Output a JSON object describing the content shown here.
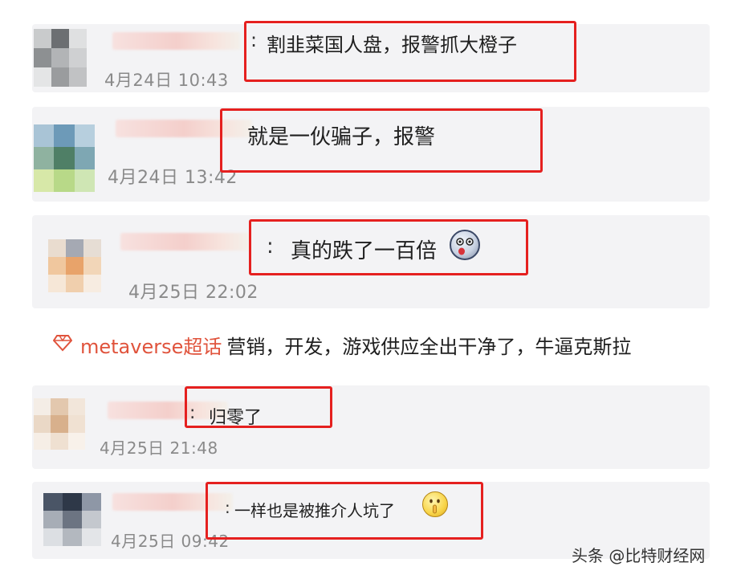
{
  "comments": [
    {
      "text": "割韭菜国人盘，报警抓大橙子",
      "time": "4月24日 10:43",
      "colon": ":"
    },
    {
      "text": "就是一伙骗子，报警",
      "time": "4月24日 13:42",
      "colon": ""
    },
    {
      "text": "真的跌了一百倍",
      "time": "4月25日 22:02",
      "colon": ":"
    },
    {
      "text": "归零了",
      "time": "4月25日 21:48",
      "colon": ":"
    },
    {
      "text": "一样也是被推介人坑了",
      "time": "4月25日 09:42",
      "colon": ":"
    }
  ],
  "topic": {
    "tag": "metaverse超话",
    "text": "营销，开发，游戏供应全出干净了，牛逼克斯拉",
    "icon": "diamond-icon"
  },
  "watermark": "头条 @比特财经网",
  "colors": {
    "highlight_border": "#e5201f",
    "topic_tag": "#e0533c",
    "card_bg": "#f3f3f5",
    "timestamp": "#8a8a8a"
  }
}
